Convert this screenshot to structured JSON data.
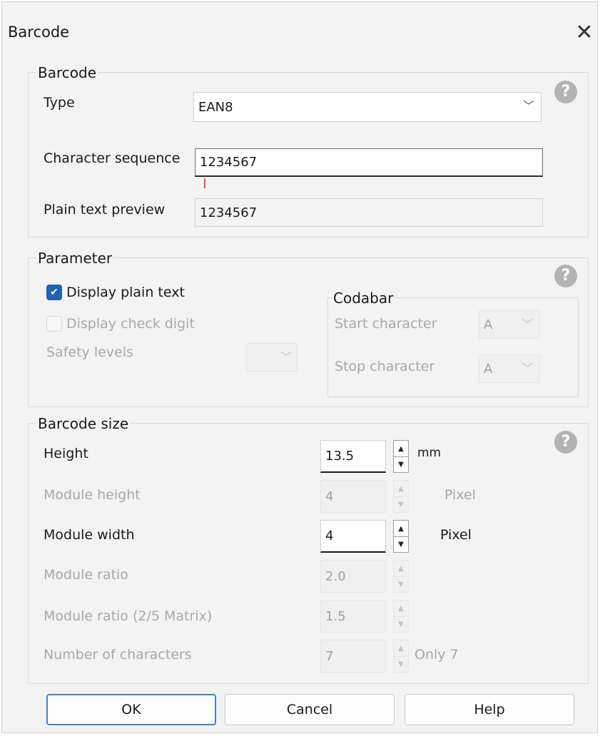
{
  "window": {
    "title": "Barcode",
    "close_glyph": "✕"
  },
  "barcode_group": {
    "legend": "Barcode",
    "help_glyph": "?",
    "type_label": "Type",
    "type_value": "EAN8",
    "char_seq_label": "Character sequence",
    "char_seq_value": "1234567",
    "preview_label": "Plain text preview",
    "preview_value": "1234567"
  },
  "parameter_group": {
    "legend": "Parameter",
    "help_glyph": "?",
    "display_plain_text": {
      "label": "Display plain text",
      "checked": true
    },
    "display_check_digit": {
      "label": "Display check digit",
      "checked": false
    },
    "safety_levels_label": "Safety levels",
    "codabar": {
      "legend": "Codabar",
      "start_label": "Start character",
      "start_value": "A",
      "stop_label": "Stop character",
      "stop_value": "A"
    }
  },
  "size_group": {
    "legend": "Barcode size",
    "help_glyph": "?",
    "height_label": "Height",
    "height_value": "13.5",
    "height_unit": "mm",
    "module_height_label": "Module height",
    "module_height_value": "4",
    "module_height_unit": "Pixel",
    "module_width_label": "Module width",
    "module_width_value": "4",
    "module_width_unit": "Pixel",
    "module_ratio_label": "Module ratio",
    "module_ratio_value": "2.0",
    "module_ratio_25_label": "Module ratio (2/5 Matrix)",
    "module_ratio_25_value": "1.5",
    "num_chars_label": "Number of characters",
    "num_chars_value": "7",
    "num_chars_note": "Only 7"
  },
  "buttons": {
    "ok": "OK",
    "cancel": "Cancel",
    "help": "Help"
  },
  "icons": {
    "close": "close-icon",
    "help": "help-circle-icon",
    "dropdown": "chevron-down-icon",
    "checkmark": "checkmark-icon",
    "spin_up": "triangle-up-icon",
    "spin_down": "triangle-down-icon"
  },
  "colors": {
    "accent": "#1f63b3",
    "dialog_bg": "#f3f3f3",
    "default_button_border": "#4a7fc1"
  }
}
